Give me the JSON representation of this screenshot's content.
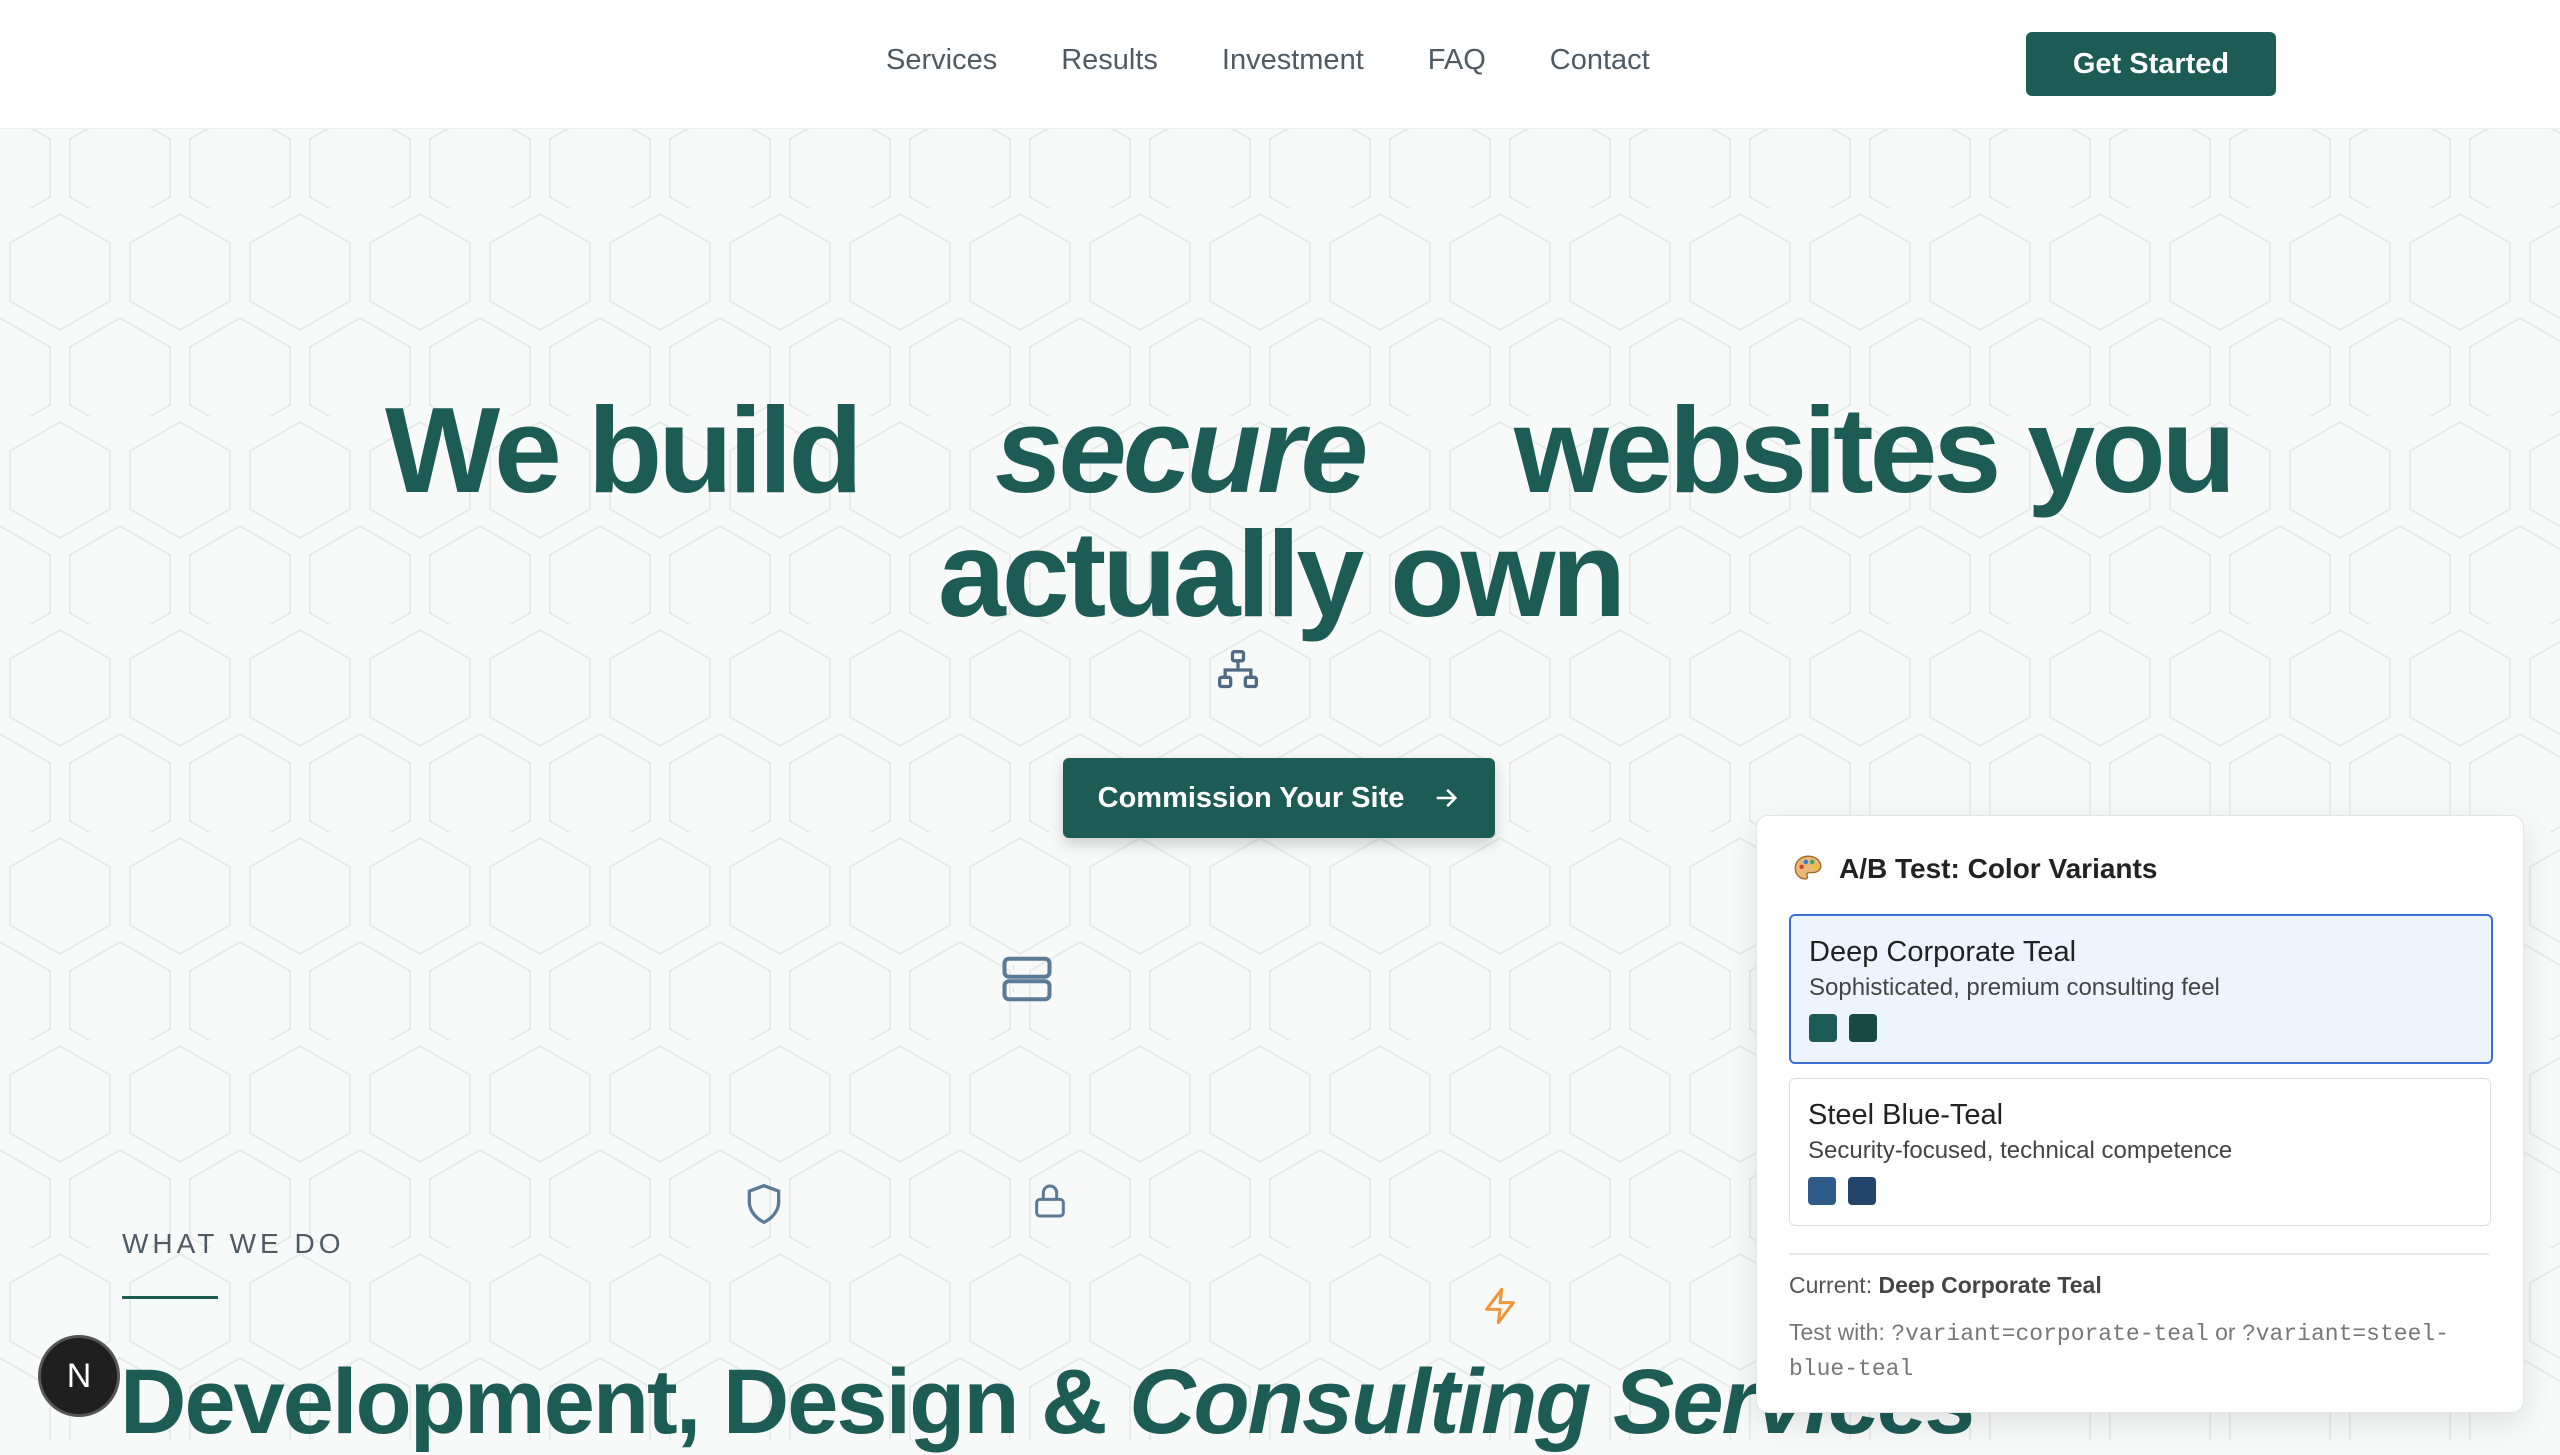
{
  "nav": {
    "items": [
      "Services",
      "Results",
      "Investment",
      "FAQ",
      "Contact"
    ],
    "cta_label": "Get Started"
  },
  "hero": {
    "word_1": "We build",
    "word_2": "secure",
    "word_3": "websites you",
    "line_2": "actually own",
    "cta_label": "Commission Your Site"
  },
  "section": {
    "eyebrow": "WHAT WE DO",
    "title_plain": "Development, Design & ",
    "title_italic": "Consulting Services"
  },
  "dev_badge": {
    "label": "N"
  },
  "ab_test": {
    "icon": "palette-icon",
    "title": "A/B Test: Color Variants",
    "variants": [
      {
        "name": "Deep Corporate Teal",
        "description": "Sophisticated, premium consulting feel",
        "colors": [
          "#1d5b55",
          "#174a45"
        ],
        "selected": true
      },
      {
        "name": "Steel Blue-Teal",
        "description": "Security-focused, technical competence",
        "colors": [
          "#2f5b8a",
          "#24456b"
        ],
        "selected": false
      }
    ],
    "current_label": "Current:",
    "current_value": "Deep Corporate Teal",
    "help_prefix": "Test with:",
    "help_param_1": "?variant=corporate-teal",
    "help_or": "or",
    "help_param_2": "?variant=steel-blue-teal"
  },
  "colors": {
    "brand": "#1d5b55",
    "accent_orange": "#f0963a",
    "icon_blue": "#5b7a95",
    "selected_border": "#3b6fd4"
  }
}
